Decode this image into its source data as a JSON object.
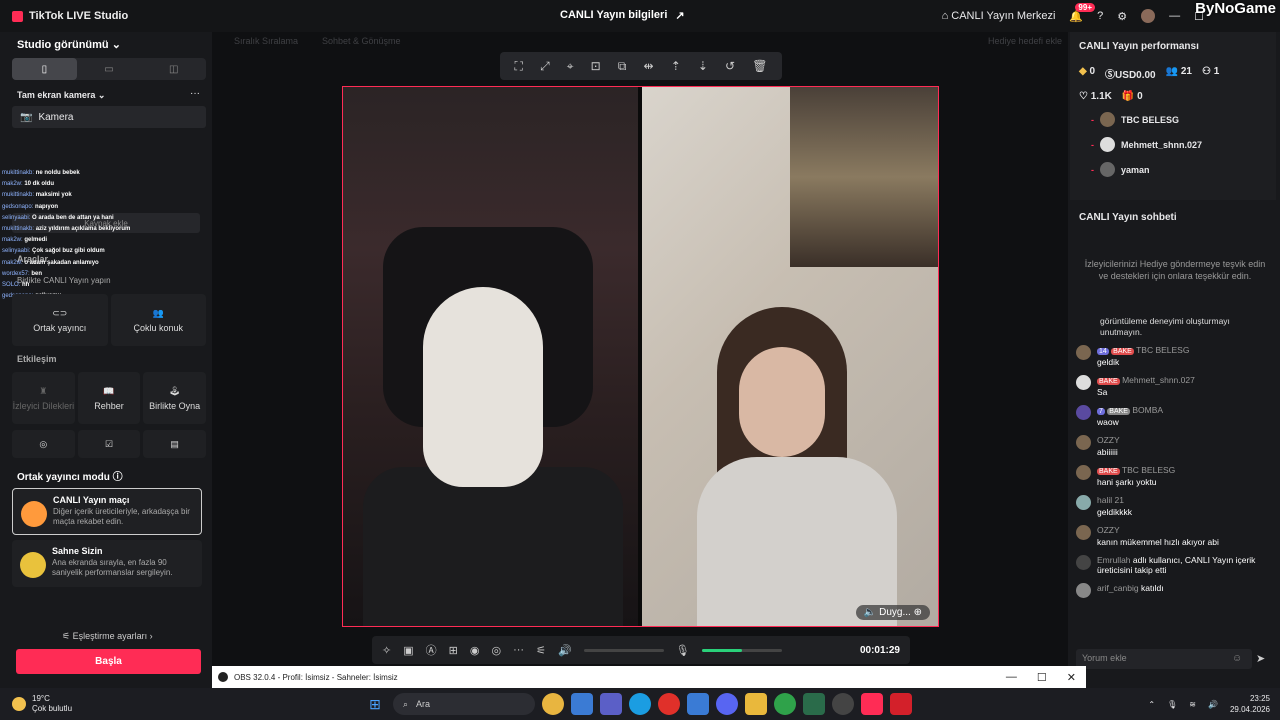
{
  "titlebar": {
    "app_title": "TikTok LIVE Studio",
    "center_title": "CANLI Yayın bilgileri",
    "center_btn": "CANLI Yayın Merkezi",
    "badge": "99+",
    "watermark": "ByNoGame"
  },
  "left": {
    "studio_view": "Studio görünümü",
    "camera_section": "Tam ekran kamera",
    "camera_item": "Kamera",
    "add_source": "Kaynak ekle",
    "tools": "Araçlar",
    "cohost_label": "Birlikte CANLI Yayın yapın",
    "tool_row1": [
      "Ortak yayıncı",
      "Çoklu konuk"
    ],
    "interaction": "Etkileşim",
    "tool_row2": [
      "İzleyici Dilekleri",
      "Rehber",
      "Birlikte Oyna"
    ],
    "cohost_mode": "Ortak yayıncı modu",
    "mode1_title": "CANLI Yayın maçı",
    "mode1_desc": "Diğer içerik üreticileriyle, arkadaşça bir maçta rekabet edin.",
    "mode2_title": "Sahne Sizin",
    "mode2_desc": "Ana ekranda sırayla, en fazla 90 saniyelik performanslar sergileyin.",
    "matching": "Eşleştirme ayarları",
    "start": "Başla",
    "overlay_chat": [
      {
        "n": "mukittinakb:",
        "t": "ne noldu bebek"
      },
      {
        "n": "mak2w:",
        "t": "10 dk oldu"
      },
      {
        "n": "mukittinakb:",
        "t": "maksimi yok"
      },
      {
        "n": "gedsonapo:",
        "t": "napıyon"
      },
      {
        "n": "selinyaabi:",
        "t": "O arada ben de attan ya hani"
      },
      {
        "n": "mukittinakb:",
        "t": "aziz yıldırım açıklama bekliyorum"
      },
      {
        "n": "mak2w:",
        "t": "gelmedi"
      },
      {
        "n": "selinyaabi:",
        "t": "Çok sağol buz gibi oldum"
      },
      {
        "n": "mak2w:",
        "t": "o adam şakadan anlamıyo"
      },
      {
        "n": "wordex57:",
        "t": "ben"
      },
      {
        "n": "SOLO:",
        "t": "hh"
      },
      {
        "n": "gedsonapo:",
        "t": "geliyomu"
      }
    ]
  },
  "center": {
    "ghost_tabs": [
      "Sıralık Sıralama",
      "Sohbet & Gönüşme",
      "Hediye hedefi ekle"
    ],
    "duyg": "Duyg...",
    "timer": "00:01:29"
  },
  "right": {
    "perf_title": "CANLI Yayın performansı",
    "stats": [
      "0",
      "USD0.00",
      "21",
      "1"
    ],
    "stats2": [
      "1.1K",
      "0"
    ],
    "ranking": [
      {
        "name": "TBC BELESG"
      },
      {
        "name": "Mehmett_shnn.027"
      },
      {
        "name": "yaman"
      }
    ],
    "chat_title": "CANLI Yayın sohbeti",
    "chat_tip": "İzleyicilerinizi Hediye göndermeye teşvik edin ve destekleri için onlara teşekkür edin.",
    "partial": "görüntüleme deneyimi oluşturmayı unutmayın.",
    "messages": [
      {
        "badge": "14",
        "badge2": "BAKE",
        "name": "TBC BELESG",
        "text": "geldik"
      },
      {
        "badge": "",
        "badge2": "BAKE",
        "name": "Mehmett_shnn.027",
        "text": "Sa"
      },
      {
        "badge": "7",
        "badge2": "BAKE",
        "name": "BOMBA",
        "text": "waow"
      },
      {
        "badge": "",
        "badge2": "",
        "name": "OZZY",
        "text": "abiiiiii"
      },
      {
        "badge": "",
        "badge2": "BAKE",
        "name": "TBC BELESG",
        "text": "hani şarkı yoktu"
      },
      {
        "badge": "",
        "badge2": "",
        "name": "halil 21",
        "text": "geldikkkk"
      },
      {
        "badge": "",
        "badge2": "",
        "name": "OZZY",
        "text": "kanın mükemmel hızlı akıyor abi"
      },
      {
        "badge": "",
        "badge2": "",
        "name": "Emrullah",
        "text": "adlı kullanıcı, CANLI Yayın içerik üreticisini takip etti"
      },
      {
        "badge": "",
        "badge2": "",
        "name": "arif_canbig",
        "text": "katıldı"
      }
    ],
    "comment_placeholder": "Yorum ekle"
  },
  "obs": {
    "title": "OBS 32.0.4 - Profil: İsimsiz - Sahneler: İsimsiz"
  },
  "taskbar": {
    "temp": "19°C",
    "weather": "Çok bulutlu",
    "search": "Ara",
    "time": "23:25",
    "date": "29.04.2026"
  }
}
